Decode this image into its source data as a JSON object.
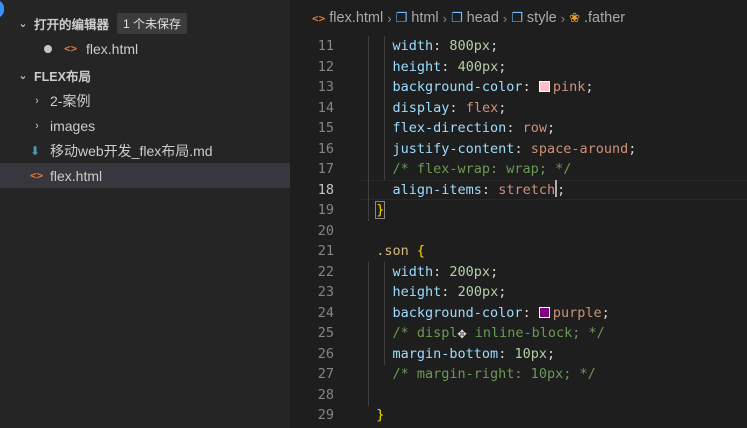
{
  "sidebar": {
    "open_editors": {
      "title": "打开的编辑器",
      "badge": "1 个未保存"
    },
    "open_file": {
      "name": "flex.html",
      "icon": "html-file-icon"
    },
    "workspace": {
      "title": "FLEX布局"
    },
    "tree": [
      {
        "label": "2-案例",
        "type": "folder"
      },
      {
        "label": "images",
        "type": "folder"
      },
      {
        "label": "移动web开发_flex布局.md",
        "type": "markdown"
      },
      {
        "label": "flex.html",
        "type": "html",
        "selected": true
      }
    ]
  },
  "breadcrumb": {
    "file": "flex.html",
    "items": [
      "html",
      "head",
      "style",
      ".father"
    ]
  },
  "editor": {
    "line_numbers": [
      "11",
      "12",
      "13",
      "14",
      "15",
      "16",
      "17",
      "18",
      "19",
      "20",
      "21",
      "22",
      "23",
      "24",
      "25",
      "26",
      "27",
      "28",
      "29"
    ],
    "current_line": "18",
    "colors": {
      "pink": "#ffc0cb",
      "purple": "#800080"
    },
    "lines": {
      "l11": {
        "prop": "width",
        "val": "800px"
      },
      "l12": {
        "prop": "height",
        "val": "400px"
      },
      "l13": {
        "prop": "background-color",
        "val": "pink"
      },
      "l14": {
        "prop": "display",
        "val": "flex"
      },
      "l15": {
        "prop": "flex-direction",
        "val": "row"
      },
      "l16": {
        "prop": "justify-content",
        "val": "space-around"
      },
      "l17": {
        "comment": "/* flex-wrap: wrap; */"
      },
      "l18": {
        "prop": "align-items",
        "val": "stretch"
      },
      "l19": {
        "brace": "}"
      },
      "l21": {
        "selector": ".son",
        "brace": "{"
      },
      "l22": {
        "prop": "width",
        "val": "200px"
      },
      "l23": {
        "prop": "height",
        "val": "200px"
      },
      "l24": {
        "prop": "background-color",
        "val": "purple"
      },
      "l25": {
        "comment_a": "/* displ",
        "comment_b": " inline-block; */"
      },
      "l26": {
        "prop": "margin-bottom",
        "val": "10px"
      },
      "l27": {
        "comment": "/* margin-right: 10px; */"
      },
      "l29": {
        "brace": "}"
      }
    }
  }
}
